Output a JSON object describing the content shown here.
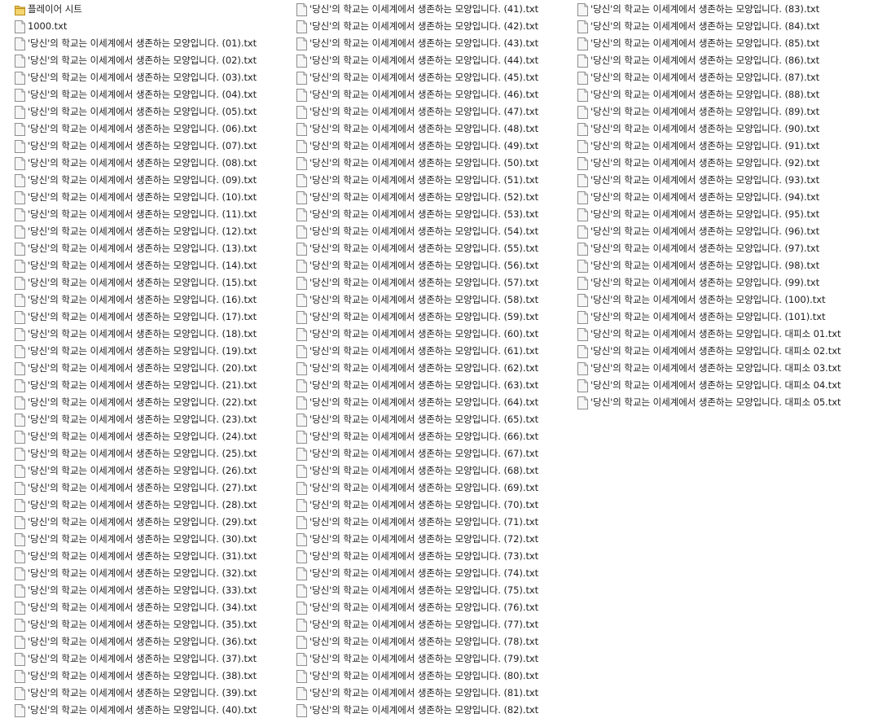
{
  "file_view": {
    "columns": [
      {
        "items": [
          {
            "name": "플레이어 시트",
            "type": "folder"
          },
          {
            "name": "1000.txt",
            "type": "file"
          },
          {
            "name": "'당신'의 학교는 이세계에서 생존하는 모양입니다. (01).txt",
            "type": "file"
          },
          {
            "name": "'당신'의 학교는 이세계에서 생존하는 모양입니다. (02).txt",
            "type": "file"
          },
          {
            "name": "'당신'의 학교는 이세계에서 생존하는 모양입니다. (03).txt",
            "type": "file"
          },
          {
            "name": "'당신'의 학교는 이세계에서 생존하는 모양입니다. (04).txt",
            "type": "file"
          },
          {
            "name": "'당신'의 학교는 이세계에서 생존하는 모양입니다. (05).txt",
            "type": "file"
          },
          {
            "name": "'당신'의 학교는 이세계에서 생존하는 모양입니다. (06).txt",
            "type": "file"
          },
          {
            "name": "'당신'의 학교는 이세계에서 생존하는 모양입니다. (07).txt",
            "type": "file"
          },
          {
            "name": "'당신'의 학교는 이세계에서 생존하는 모양입니다. (08).txt",
            "type": "file"
          },
          {
            "name": "'당신'의 학교는 이세계에서 생존하는 모양입니다. (09).txt",
            "type": "file"
          },
          {
            "name": "'당신'의 학교는 이세계에서 생존하는 모양입니다. (10).txt",
            "type": "file"
          },
          {
            "name": "'당신'의 학교는 이세계에서 생존하는 모양입니다. (11).txt",
            "type": "file"
          },
          {
            "name": "'당신'의 학교는 이세계에서 생존하는 모양입니다. (12).txt",
            "type": "file"
          },
          {
            "name": "'당신'의 학교는 이세계에서 생존하는 모양입니다. (13).txt",
            "type": "file"
          },
          {
            "name": "'당신'의 학교는 이세계에서 생존하는 모양입니다. (14).txt",
            "type": "file"
          },
          {
            "name": "'당신'의 학교는 이세계에서 생존하는 모양입니다. (15).txt",
            "type": "file"
          },
          {
            "name": "'당신'의 학교는 이세계에서 생존하는 모양입니다. (16).txt",
            "type": "file"
          },
          {
            "name": "'당신'의 학교는 이세계에서 생존하는 모양입니다. (17).txt",
            "type": "file"
          },
          {
            "name": "'당신'의 학교는 이세계에서 생존하는 모양입니다. (18).txt",
            "type": "file"
          },
          {
            "name": "'당신'의 학교는 이세계에서 생존하는 모양입니다. (19).txt",
            "type": "file"
          },
          {
            "name": "'당신'의 학교는 이세계에서 생존하는 모양입니다. (20).txt",
            "type": "file"
          },
          {
            "name": "'당신'의 학교는 이세계에서 생존하는 모양입니다. (21).txt",
            "type": "file"
          },
          {
            "name": "'당신'의 학교는 이세계에서 생존하는 모양입니다. (22).txt",
            "type": "file"
          },
          {
            "name": "'당신'의 학교는 이세계에서 생존하는 모양입니다. (23).txt",
            "type": "file"
          },
          {
            "name": "'당신'의 학교는 이세계에서 생존하는 모양입니다. (24).txt",
            "type": "file"
          },
          {
            "name": "'당신'의 학교는 이세계에서 생존하는 모양입니다. (25).txt",
            "type": "file"
          },
          {
            "name": "'당신'의 학교는 이세계에서 생존하는 모양입니다. (26).txt",
            "type": "file"
          },
          {
            "name": "'당신'의 학교는 이세계에서 생존하는 모양입니다. (27).txt",
            "type": "file"
          },
          {
            "name": "'당신'의 학교는 이세계에서 생존하는 모양입니다. (28).txt",
            "type": "file"
          },
          {
            "name": "'당신'의 학교는 이세계에서 생존하는 모양입니다. (29).txt",
            "type": "file"
          },
          {
            "name": "'당신'의 학교는 이세계에서 생존하는 모양입니다. (30).txt",
            "type": "file"
          },
          {
            "name": "'당신'의 학교는 이세계에서 생존하는 모양입니다. (31).txt",
            "type": "file"
          },
          {
            "name": "'당신'의 학교는 이세계에서 생존하는 모양입니다. (32).txt",
            "type": "file"
          },
          {
            "name": "'당신'의 학교는 이세계에서 생존하는 모양입니다. (33).txt",
            "type": "file"
          },
          {
            "name": "'당신'의 학교는 이세계에서 생존하는 모양입니다. (34).txt",
            "type": "file"
          },
          {
            "name": "'당신'의 학교는 이세계에서 생존하는 모양입니다. (35).txt",
            "type": "file"
          },
          {
            "name": "'당신'의 학교는 이세계에서 생존하는 모양입니다. (36).txt",
            "type": "file"
          },
          {
            "name": "'당신'의 학교는 이세계에서 생존하는 모양입니다. (37).txt",
            "type": "file"
          },
          {
            "name": "'당신'의 학교는 이세계에서 생존하는 모양입니다. (38).txt",
            "type": "file"
          },
          {
            "name": "'당신'의 학교는 이세계에서 생존하는 모양입니다. (39).txt",
            "type": "file"
          },
          {
            "name": "'당신'의 학교는 이세계에서 생존하는 모양입니다. (40).txt",
            "type": "file"
          }
        ]
      },
      {
        "items": [
          {
            "name": "'당신'의 학교는 이세계에서 생존하는 모양입니다. (41).txt",
            "type": "file"
          },
          {
            "name": "'당신'의 학교는 이세계에서 생존하는 모양입니다. (42).txt",
            "type": "file"
          },
          {
            "name": "'당신'의 학교는 이세계에서 생존하는 모양입니다. (43).txt",
            "type": "file"
          },
          {
            "name": "'당신'의 학교는 이세계에서 생존하는 모양입니다. (44).txt",
            "type": "file"
          },
          {
            "name": "'당신'의 학교는 이세계에서 생존하는 모양입니다. (45).txt",
            "type": "file"
          },
          {
            "name": "'당신'의 학교는 이세계에서 생존하는 모양입니다. (46).txt",
            "type": "file"
          },
          {
            "name": "'당신'의 학교는 이세계에서 생존하는 모양입니다. (47).txt",
            "type": "file"
          },
          {
            "name": "'당신'의 학교는 이세계에서 생존하는 모양입니다. (48).txt",
            "type": "file"
          },
          {
            "name": "'당신'의 학교는 이세계에서 생존하는 모양입니다. (49).txt",
            "type": "file"
          },
          {
            "name": "'당신'의 학교는 이세계에서 생존하는 모양입니다. (50).txt",
            "type": "file"
          },
          {
            "name": "'당신'의 학교는 이세계에서 생존하는 모양입니다. (51).txt",
            "type": "file"
          },
          {
            "name": "'당신'의 학교는 이세계에서 생존하는 모양입니다. (52).txt",
            "type": "file"
          },
          {
            "name": "'당신'의 학교는 이세계에서 생존하는 모양입니다. (53).txt",
            "type": "file"
          },
          {
            "name": "'당신'의 학교는 이세계에서 생존하는 모양입니다. (54).txt",
            "type": "file"
          },
          {
            "name": "'당신'의 학교는 이세계에서 생존하는 모양입니다. (55).txt",
            "type": "file"
          },
          {
            "name": "'당신'의 학교는 이세계에서 생존하는 모양입니다. (56).txt",
            "type": "file"
          },
          {
            "name": "'당신'의 학교는 이세계에서 생존하는 모양입니다. (57).txt",
            "type": "file"
          },
          {
            "name": "'당신'의 학교는 이세계에서 생존하는 모양입니다. (58).txt",
            "type": "file"
          },
          {
            "name": "'당신'의 학교는 이세계에서 생존하는 모양입니다. (59).txt",
            "type": "file"
          },
          {
            "name": "'당신'의 학교는 이세계에서 생존하는 모양입니다. (60).txt",
            "type": "file"
          },
          {
            "name": "'당신'의 학교는 이세계에서 생존하는 모양입니다. (61).txt",
            "type": "file"
          },
          {
            "name": "'당신'의 학교는 이세계에서 생존하는 모양입니다. (62).txt",
            "type": "file"
          },
          {
            "name": "'당신'의 학교는 이세계에서 생존하는 모양입니다. (63).txt",
            "type": "file"
          },
          {
            "name": "'당신'의 학교는 이세계에서 생존하는 모양입니다. (64).txt",
            "type": "file"
          },
          {
            "name": "'당신'의 학교는 이세계에서 생존하는 모양입니다. (65).txt",
            "type": "file"
          },
          {
            "name": "'당신'의 학교는 이세계에서 생존하는 모양입니다. (66).txt",
            "type": "file"
          },
          {
            "name": "'당신'의 학교는 이세계에서 생존하는 모양입니다. (67).txt",
            "type": "file"
          },
          {
            "name": "'당신'의 학교는 이세계에서 생존하는 모양입니다. (68).txt",
            "type": "file"
          },
          {
            "name": "'당신'의 학교는 이세계에서 생존하는 모양입니다. (69).txt",
            "type": "file"
          },
          {
            "name": "'당신'의 학교는 이세계에서 생존하는 모양입니다. (70).txt",
            "type": "file"
          },
          {
            "name": "'당신'의 학교는 이세계에서 생존하는 모양입니다. (71).txt",
            "type": "file"
          },
          {
            "name": "'당신'의 학교는 이세계에서 생존하는 모양입니다. (72).txt",
            "type": "file"
          },
          {
            "name": "'당신'의 학교는 이세계에서 생존하는 모양입니다. (73).txt",
            "type": "file"
          },
          {
            "name": "'당신'의 학교는 이세계에서 생존하는 모양입니다. (74).txt",
            "type": "file"
          },
          {
            "name": "'당신'의 학교는 이세계에서 생존하는 모양입니다. (75).txt",
            "type": "file"
          },
          {
            "name": "'당신'의 학교는 이세계에서 생존하는 모양입니다. (76).txt",
            "type": "file"
          },
          {
            "name": "'당신'의 학교는 이세계에서 생존하는 모양입니다. (77).txt",
            "type": "file"
          },
          {
            "name": "'당신'의 학교는 이세계에서 생존하는 모양입니다. (78).txt",
            "type": "file"
          },
          {
            "name": "'당신'의 학교는 이세계에서 생존하는 모양입니다. (79).txt",
            "type": "file"
          },
          {
            "name": "'당신'의 학교는 이세계에서 생존하는 모양입니다. (80).txt",
            "type": "file"
          },
          {
            "name": "'당신'의 학교는 이세계에서 생존하는 모양입니다. (81).txt",
            "type": "file"
          },
          {
            "name": "'당신'의 학교는 이세계에서 생존하는 모양입니다. (82).txt",
            "type": "file"
          }
        ]
      },
      {
        "items": [
          {
            "name": "'당신'의 학교는 이세계에서 생존하는 모양입니다. (83).txt",
            "type": "file"
          },
          {
            "name": "'당신'의 학교는 이세계에서 생존하는 모양입니다. (84).txt",
            "type": "file"
          },
          {
            "name": "'당신'의 학교는 이세계에서 생존하는 모양입니다. (85).txt",
            "type": "file"
          },
          {
            "name": "'당신'의 학교는 이세계에서 생존하는 모양입니다. (86).txt",
            "type": "file"
          },
          {
            "name": "'당신'의 학교는 이세계에서 생존하는 모양입니다. (87).txt",
            "type": "file"
          },
          {
            "name": "'당신'의 학교는 이세계에서 생존하는 모양입니다. (88).txt",
            "type": "file"
          },
          {
            "name": "'당신'의 학교는 이세계에서 생존하는 모양입니다. (89).txt",
            "type": "file"
          },
          {
            "name": "'당신'의 학교는 이세계에서 생존하는 모양입니다. (90).txt",
            "type": "file"
          },
          {
            "name": "'당신'의 학교는 이세계에서 생존하는 모양입니다. (91).txt",
            "type": "file"
          },
          {
            "name": "'당신'의 학교는 이세계에서 생존하는 모양입니다. (92).txt",
            "type": "file"
          },
          {
            "name": "'당신'의 학교는 이세계에서 생존하는 모양입니다. (93).txt",
            "type": "file"
          },
          {
            "name": "'당신'의 학교는 이세계에서 생존하는 모양입니다. (94).txt",
            "type": "file"
          },
          {
            "name": "'당신'의 학교는 이세계에서 생존하는 모양입니다. (95).txt",
            "type": "file"
          },
          {
            "name": "'당신'의 학교는 이세계에서 생존하는 모양입니다. (96).txt",
            "type": "file"
          },
          {
            "name": "'당신'의 학교는 이세계에서 생존하는 모양입니다. (97).txt",
            "type": "file"
          },
          {
            "name": "'당신'의 학교는 이세계에서 생존하는 모양입니다. (98).txt",
            "type": "file"
          },
          {
            "name": "'당신'의 학교는 이세계에서 생존하는 모양입니다. (99).txt",
            "type": "file"
          },
          {
            "name": "'당신'의 학교는 이세계에서 생존하는 모양입니다. (100).txt",
            "type": "file"
          },
          {
            "name": "'당신'의 학교는 이세계에서 생존하는 모양입니다. (101).txt",
            "type": "file"
          },
          {
            "name": "'당신'의 학교는 이세계에서 생존하는 모양입니다. 대피소 01.txt",
            "type": "file"
          },
          {
            "name": "'당신'의 학교는 이세계에서 생존하는 모양입니다. 대피소 02.txt",
            "type": "file"
          },
          {
            "name": "'당신'의 학교는 이세계에서 생존하는 모양입니다. 대피소 03.txt",
            "type": "file"
          },
          {
            "name": "'당신'의 학교는 이세계에서 생존하는 모양입니다. 대피소 04.txt",
            "type": "file"
          },
          {
            "name": "'당신'의 학교는 이세계에서 생존하는 모양입니다. 대피소 05.txt",
            "type": "file"
          }
        ]
      }
    ]
  },
  "icons": {
    "folder": "folder-icon",
    "file": "text-file-icon"
  },
  "colors": {
    "background": "#ffffff",
    "text": "#1e1e1e",
    "folder_icon": "#e8c050"
  }
}
